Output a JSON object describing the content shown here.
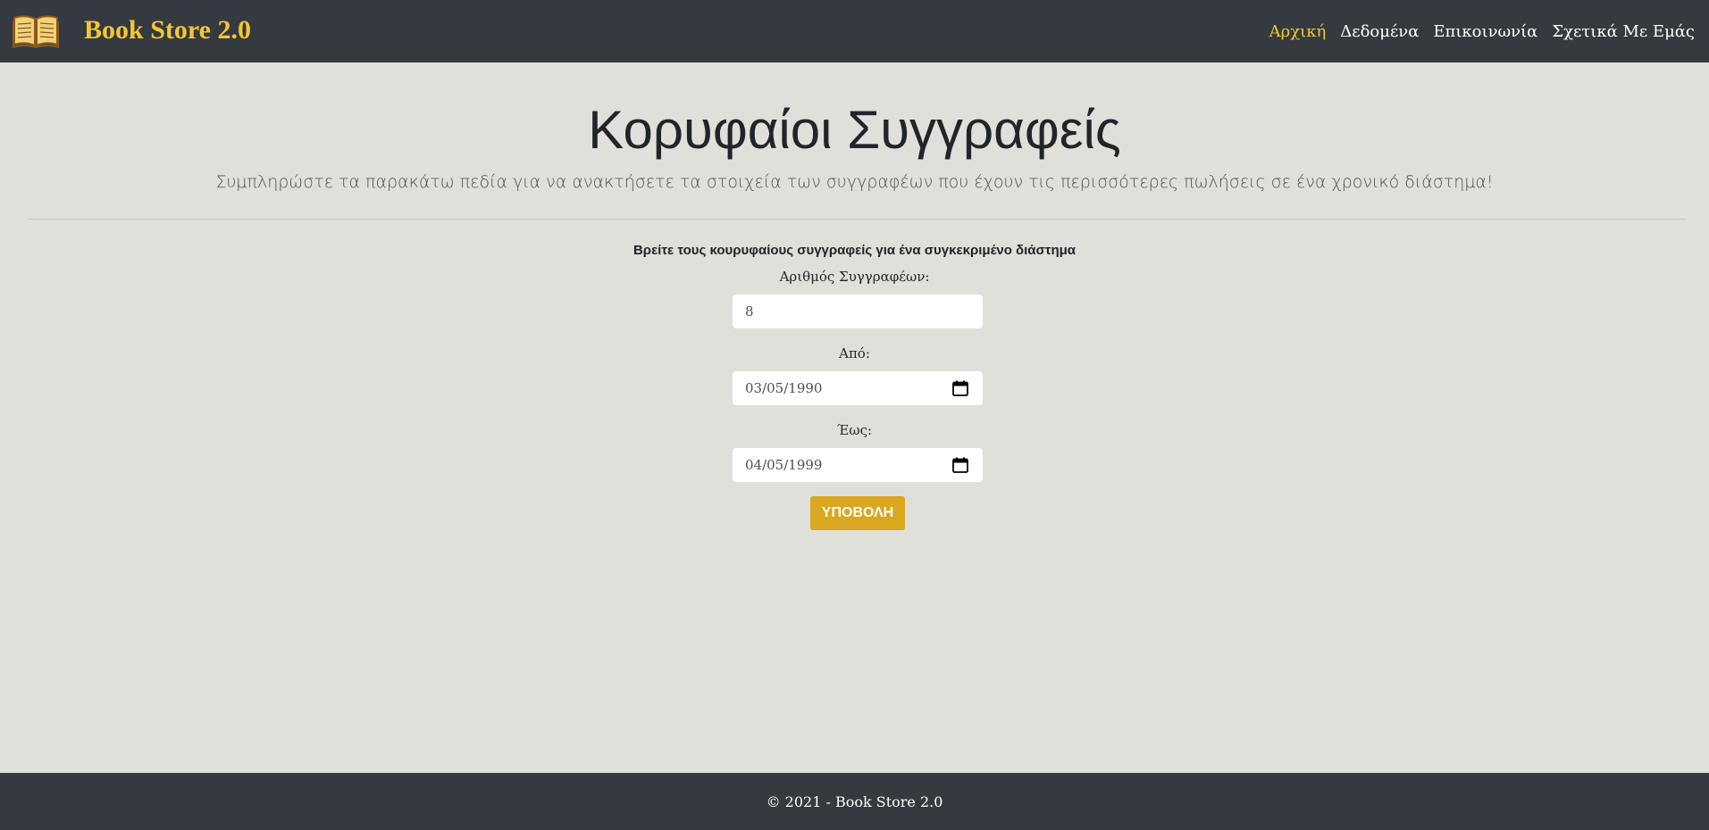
{
  "brand": {
    "title": "Book Store 2.0",
    "icon": "open-book-icon"
  },
  "nav": {
    "items": [
      {
        "label": "Αρχική",
        "active": true
      },
      {
        "label": "Δεδομένα",
        "active": false
      },
      {
        "label": "Επικοινωνία",
        "active": false
      },
      {
        "label": "Σχετικά Με Εμάς",
        "active": false
      }
    ]
  },
  "main": {
    "title": "Κορυφαίοι Συγγραφείς",
    "subtitle": "Συμπληρώστε τα παρακάτω πεδία για να ανακτήσετε τα στοιχεία των συγγραφέων που έχουν τις περισσότερες πωλήσεις σε ένα χρονικό διάστημα!"
  },
  "form": {
    "heading": "Βρείτε τους κουρυφαίους συγγραφείς για ένα συγκεκριμένο διάστημα",
    "count_label": "Αριθμός Συγγραφέων:",
    "count_value": "8",
    "from_label": "Από:",
    "from_value": "03/05/1990",
    "to_label": "Έως:",
    "to_value": "04/05/1999",
    "submit_label": "ΥΠΟΒΟΛΗ"
  },
  "footer": {
    "text": "© 2021 - Book Store 2.0"
  },
  "colors": {
    "navbar_bg": "#343a40",
    "accent": "#f5c631",
    "page_bg": "#dfe0da",
    "button": "#dba620"
  }
}
